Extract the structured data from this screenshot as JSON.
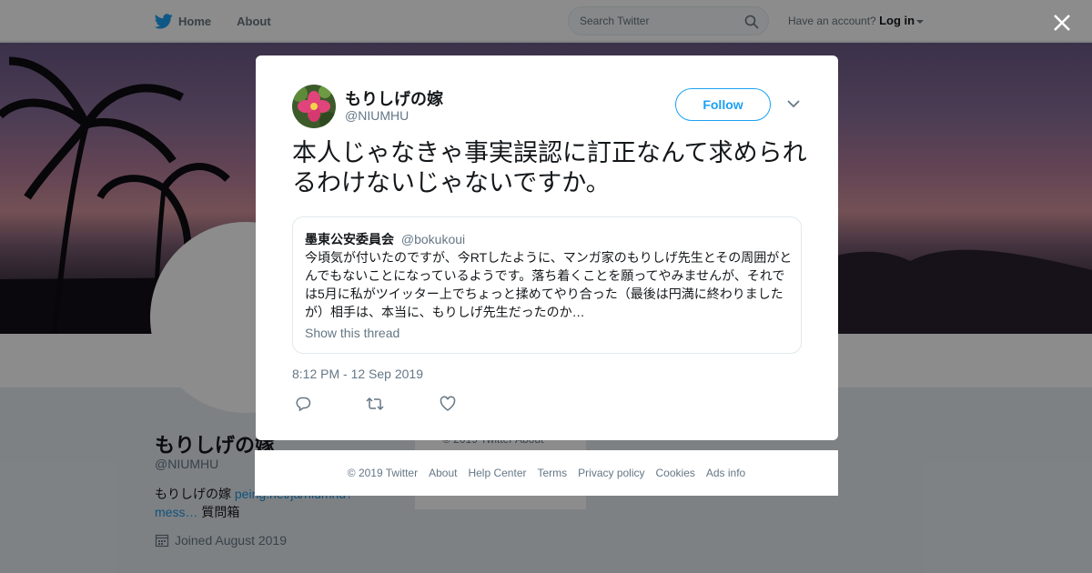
{
  "nav": {
    "home_label": "Home",
    "about_label": "About",
    "search_placeholder": "Search Twitter",
    "account_prompt": "Have an account?",
    "login_label": "Log in"
  },
  "profile": {
    "name": "もりしげの嫁",
    "handle": "@NIUMHU",
    "bio_text": "もりしげの嫁",
    "bio_link": "peing.net/ja/niumhu?mess…",
    "bio_suffix": "質問箱",
    "joined": "Joined August 2019",
    "side_card_text": "© 2019 Twitter  About"
  },
  "tweet": {
    "author_name": "もりしげの嫁",
    "author_handle": "@NIUMHU",
    "follow_label": "Follow",
    "text": "本人じゃなきゃ事実誤認に訂正なんて求められるわけないじゃないですか。",
    "timestamp": "8:12 PM - 12 Sep 2019",
    "quote": {
      "name": "墨東公安委員会",
      "handle": "@bokukoui",
      "text": "今頃気が付いたのですが、今RTしたように、マンガ家のもりしげ先生とその周囲がとんでもないことになっているようです。落ち着くことを願ってやみませんが、それでは5月に私がツイッター上でちょっと揉めてやり合った（最後は円満に終わりましたが）相手は、本当に、もりしげ先生だったのか…",
      "thread_label": "Show this thread"
    }
  },
  "footer": {
    "copyright": "© 2019 Twitter",
    "about": "About",
    "help": "Help Center",
    "terms": "Terms",
    "privacy": "Privacy policy",
    "cookies": "Cookies",
    "ads": "Ads info"
  },
  "colors": {
    "accent": "#1da1f2",
    "link": "#1b95e0",
    "muted": "#657786"
  }
}
